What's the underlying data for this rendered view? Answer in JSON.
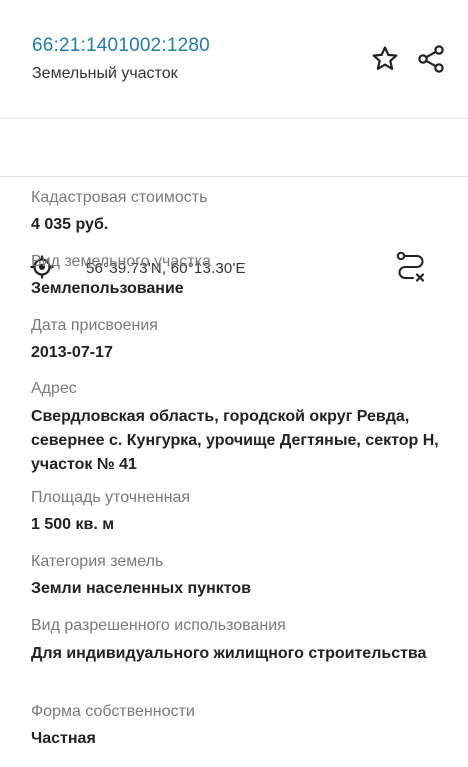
{
  "header": {
    "cadastral_number": "66:21:1401002:1280",
    "object_type": "Земельный участок",
    "icons": {
      "favorite": "star-icon",
      "share": "share-icon"
    }
  },
  "coordinates": {
    "text": "56°39.73'N, 60°13.30'E",
    "icons": {
      "locate": "crosshair-icon",
      "route": "route-icon"
    }
  },
  "fields": [
    {
      "label": "Кадастровая стоимость",
      "value": "4 035 руб."
    },
    {
      "label": "Вид земельного участка",
      "value": "Землепользование"
    },
    {
      "label": "Дата присвоения",
      "value": "2013-07-17"
    },
    {
      "label": "Адрес",
      "value": "Свердловская область, городской округ Ревда, севернее с. Кунгурка, урочище Дегтяные, сектор Н, участок № 41"
    },
    {
      "label": "Площадь уточненная",
      "value": "1 500 кв. м"
    },
    {
      "label": "Категория земель",
      "value": "Земли населенных пунктов"
    },
    {
      "label": "Вид разрешенного использования",
      "value": "Для индивидуального жилищного строительства"
    },
    {
      "label": "Форма собственности",
      "value": "Частная"
    }
  ],
  "colors": {
    "link": "#1f7fa8",
    "label": "#7a7a7a",
    "value": "#222222",
    "divider": "#e2e2e2"
  }
}
